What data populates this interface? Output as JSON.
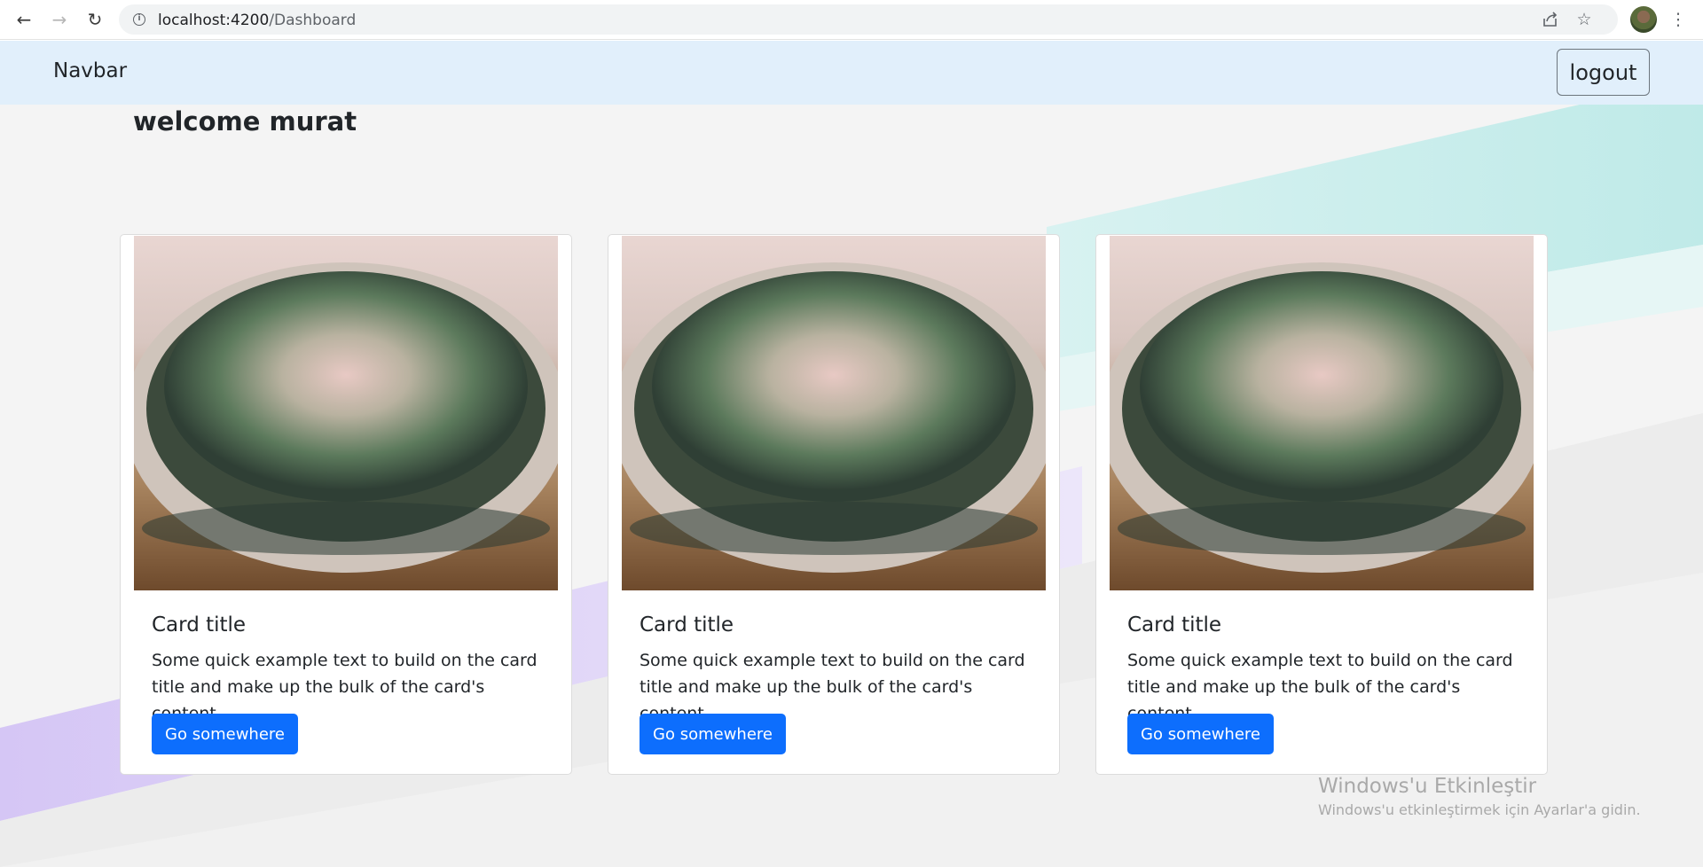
{
  "browser": {
    "url_host": "localhost:4200",
    "url_path": "/Dashboard",
    "back_icon": "arrow-left-icon",
    "forward_icon": "arrow-right-icon",
    "reload_icon": "reload-icon",
    "share_icon": "share-icon",
    "bookmark_icon": "star-icon",
    "menu_icon": "kebab-menu-icon"
  },
  "navbar": {
    "brand": "Navbar",
    "logout_label": "logout"
  },
  "welcome_text": "welcome murat",
  "cards": [
    {
      "title": "Card title",
      "text": "Some quick example text to build on the card title and make up the bulk of the card's content.",
      "button_label": "Go somewhere"
    },
    {
      "title": "Card title",
      "text": "Some quick example text to build on the card title and make up the bulk of the card's content.",
      "button_label": "Go somewhere"
    },
    {
      "title": "Card title",
      "text": "Some quick example text to build on the card title and make up the bulk of the card's content.",
      "button_label": "Go somewhere"
    }
  ],
  "watermark": {
    "title": "Windows'u Etkinleştir",
    "subtitle": "Windows'u etkinleştirmek için Ayarlar'a gidin."
  },
  "colors": {
    "navbar_bg": "#e1effb",
    "primary_button": "#0d6efd",
    "page_bg": "#f4f4f4",
    "teal_band": "#c7ecec",
    "purple_band": "#dcd2f7"
  }
}
